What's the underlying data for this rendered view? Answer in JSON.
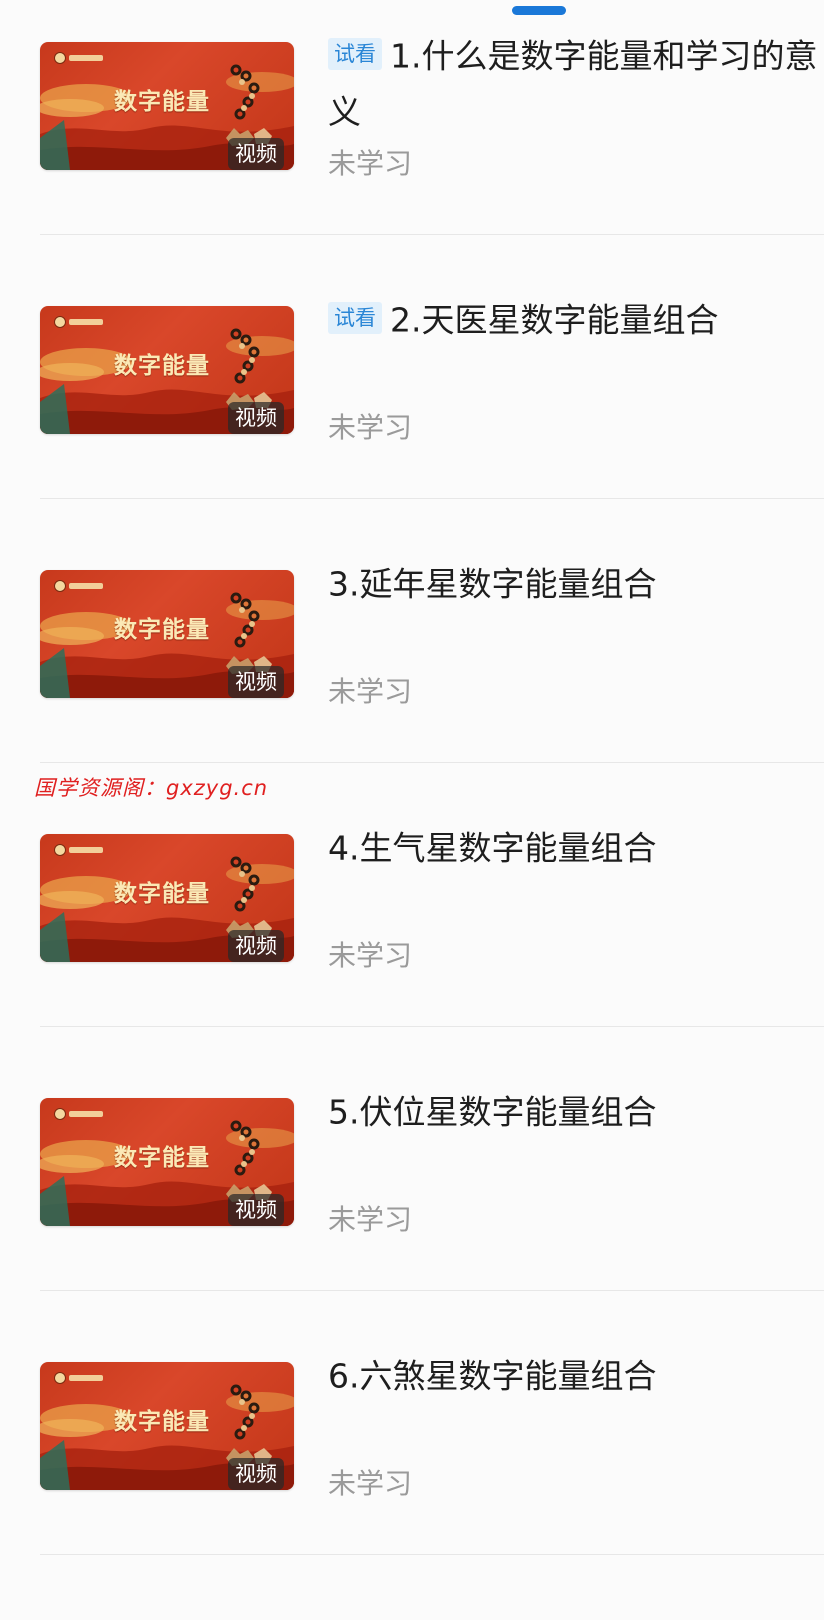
{
  "lessons": [
    {
      "tag": "试看",
      "title": "1.什么是数字能量和学习的意义",
      "status": "未学习",
      "thumb_title": "数字能量",
      "media_type": "视频"
    },
    {
      "tag": "试看",
      "title": "2.天医星数字能量组合",
      "status": "未学习",
      "thumb_title": "数字能量",
      "media_type": "视频"
    },
    {
      "tag": "",
      "title": "3.延年星数字能量组合",
      "status": "未学习",
      "thumb_title": "数字能量",
      "media_type": "视频"
    },
    {
      "tag": "",
      "title": "4.生气星数字能量组合",
      "status": "未学习",
      "thumb_title": "数字能量",
      "media_type": "视频"
    },
    {
      "tag": "",
      "title": "5.伏位星数字能量组合",
      "status": "未学习",
      "thumb_title": "数字能量",
      "media_type": "视频"
    },
    {
      "tag": "",
      "title": "6.六煞星数字能量组合",
      "status": "未学习",
      "thumb_title": "数字能量",
      "media_type": "视频"
    }
  ],
  "watermark": "国学资源阁：gxzyg.cn",
  "colors": {
    "accent": "#1a78d8",
    "trial_tag_bg": "#e2f0fb",
    "trial_tag_text": "#2a86d6",
    "thumb_red": "#c7391c",
    "watermark_red": "#e02020",
    "status_gray": "#9a9a9a"
  }
}
